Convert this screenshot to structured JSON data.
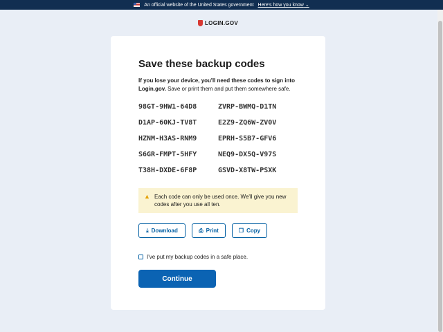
{
  "banner": {
    "text": "An official website of the United States government",
    "link": "Here's how you know",
    "chevron": "⌄"
  },
  "logo": {
    "text": "LOGIN.GOV"
  },
  "card": {
    "title": "Save these backup codes",
    "intro_bold": "If you lose your device, you'll need these codes to sign into Login.gov.",
    "intro_rest": " Save or print them and put them somewhere safe.",
    "codes": [
      "98GT-9HW1-64D8",
      "ZVRP-BWMQ-D1TN",
      "D1AP-60KJ-TV8T",
      "E2Z9-ZQ6W-ZV0V",
      "HZNM-H3AS-RNM9",
      "EPRH-S5B7-GFV6",
      "S6GR-FMPT-5HFY",
      "NEQ9-DX5Q-V97S",
      "T38H-DXDE-6F8P",
      "GSVD-X8TW-PSXK"
    ],
    "alert": "Each code can only be used once. We'll give you new codes after you use all ten.",
    "buttons": {
      "download": "Download",
      "print": "Print",
      "copy": "Copy"
    },
    "checkbox_label": "I've put my backup codes in a safe place.",
    "continue": "Continue"
  },
  "colors": {
    "banner_bg": "#112e51",
    "page_bg": "#e9eef6",
    "primary": "#0b63b3",
    "outline": "#005ea2",
    "alert_bg": "#faf3d1",
    "warning": "#e5a000",
    "logo_red": "#d83933"
  },
  "icons": {
    "flag": "us-flag-icon",
    "logo": "login-shield-icon",
    "warning": "warning-icon",
    "download": "download-icon",
    "print": "printer-icon",
    "copy": "copy-icon"
  }
}
